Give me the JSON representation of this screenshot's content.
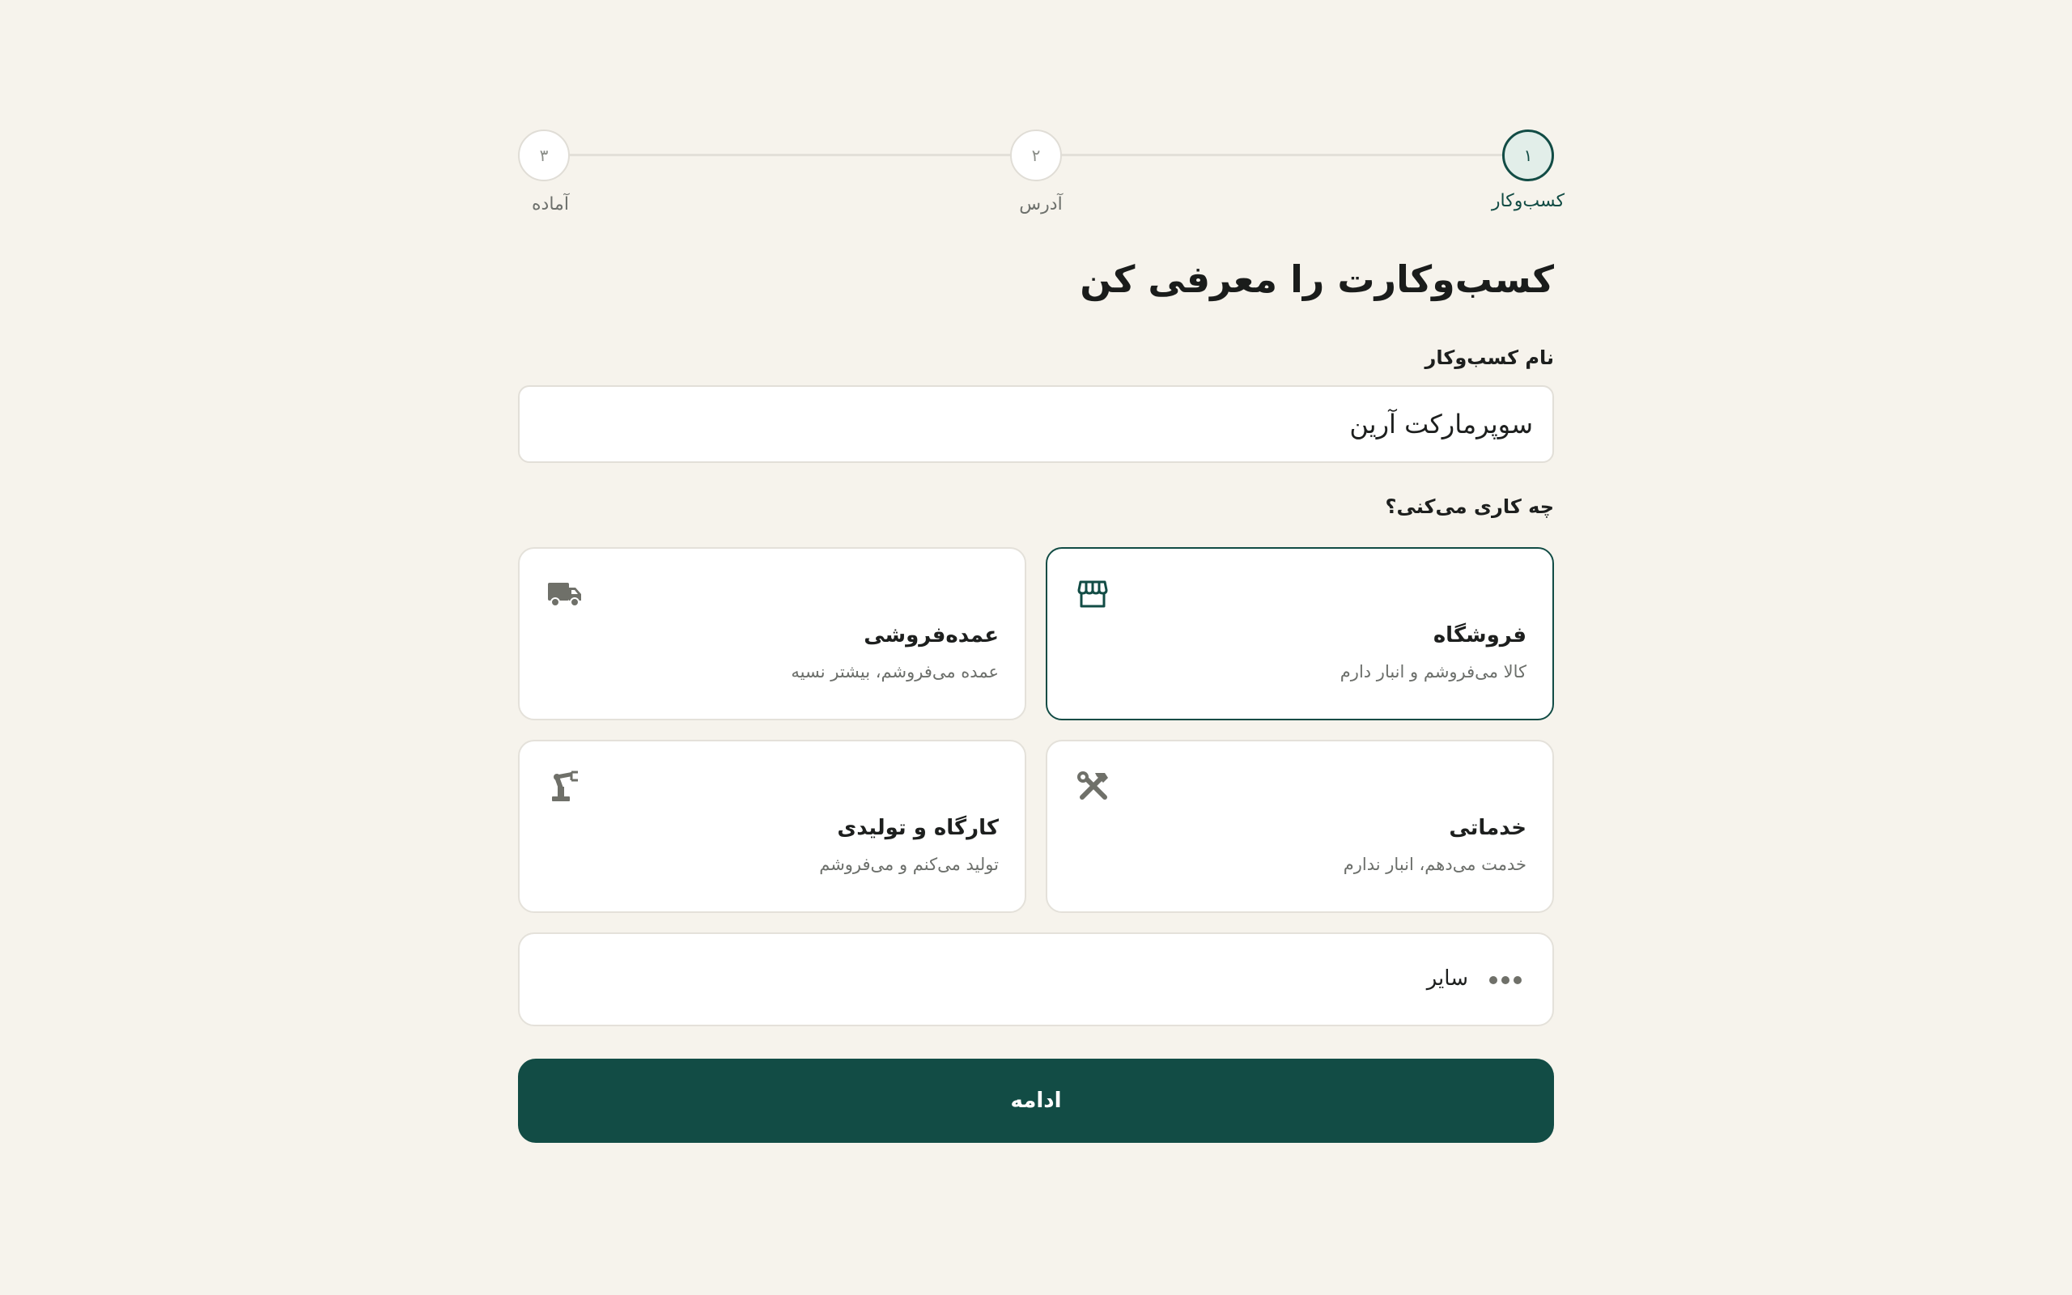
{
  "stepper": {
    "steps": [
      {
        "number": "۱",
        "label": "کسب‌وکار",
        "state": "active"
      },
      {
        "number": "۲",
        "label": "آدرس",
        "state": "upcoming"
      },
      {
        "number": "۳",
        "label": "آماده",
        "state": "upcoming"
      }
    ]
  },
  "form": {
    "title": "کسب‌وکارت را معرفی کن",
    "name_label": "نام کسب‌وکار",
    "name_value": "سوپرمارکت آرین",
    "question_label": "چه کاری می‌کنی؟",
    "options": [
      {
        "title": "فروشگاه",
        "description": "کالا می‌فروشم و انبار دارم",
        "icon": "storefront-icon",
        "selected": true
      },
      {
        "title": "عمده‌فروشی",
        "description": "عمده می‌فروشم، بیشتر نسیه",
        "icon": "truck-icon",
        "selected": false
      },
      {
        "title": "خدماتی",
        "description": "خدمت می‌دهم، انبار ندارم",
        "icon": "hammer-wrench-icon",
        "selected": false
      },
      {
        "title": "کارگاه و تولیدی",
        "description": "تولید می‌کنم و می‌فروشم",
        "icon": "robot-arm-icon",
        "selected": false
      }
    ],
    "other": {
      "label": "سایر",
      "icon": "more-dots-icon"
    },
    "continue_label": "ادامه"
  },
  "colors": {
    "background": "#f6f3ec",
    "accent": "#124c45",
    "accent_light": "#e2eee9",
    "icon_gray": "#6f7069"
  }
}
